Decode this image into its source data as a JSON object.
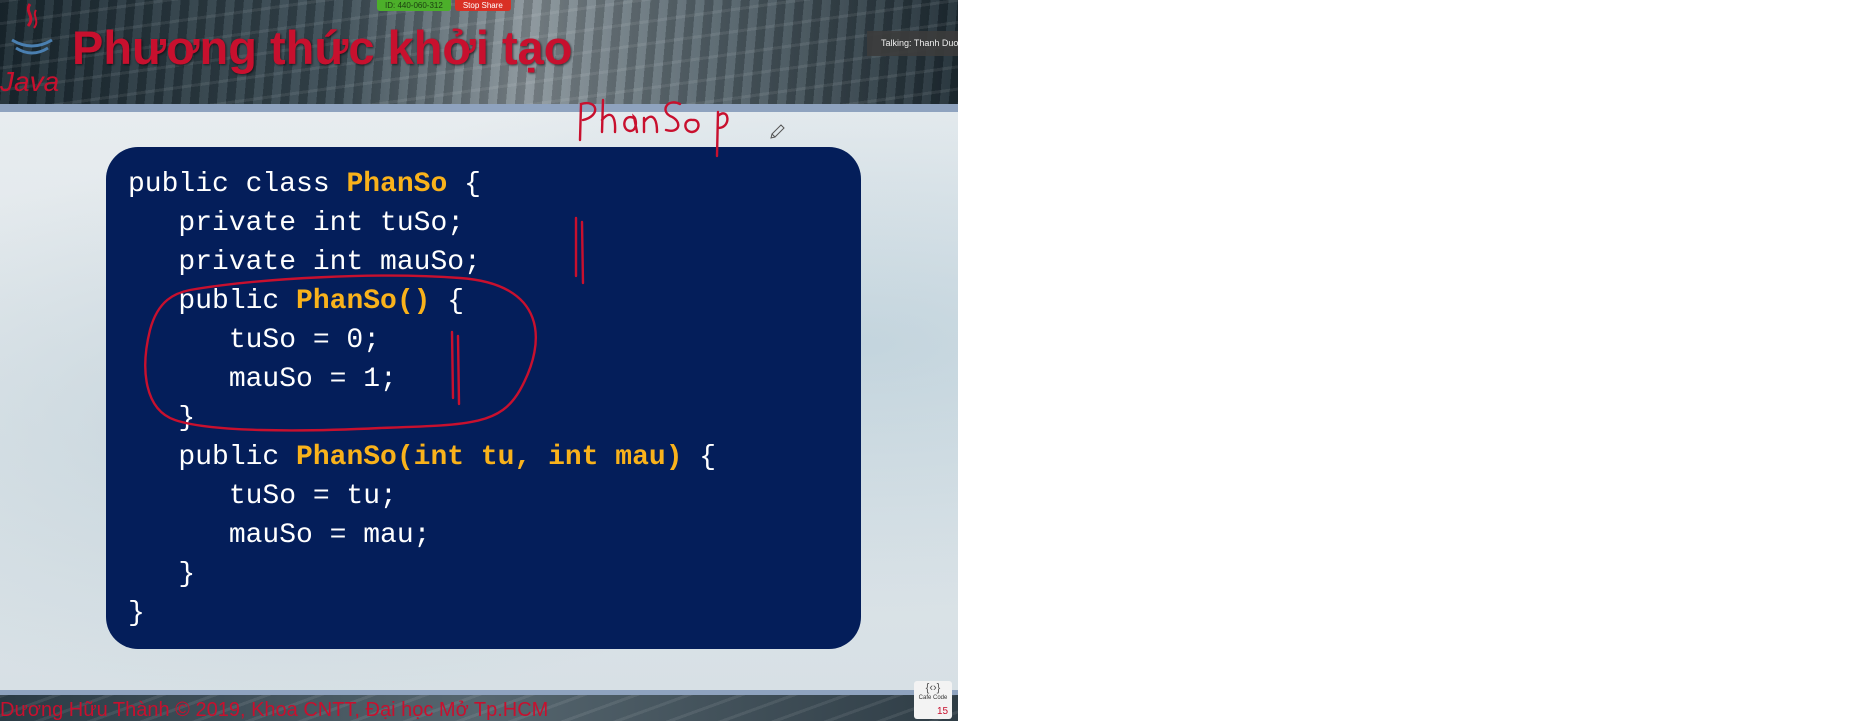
{
  "meeting": {
    "id_label": "ID: 440-060-312",
    "stop_share_label": "Stop Share",
    "talking_label": "Talking: Thanh Duo"
  },
  "slide": {
    "logo_text": "Java",
    "title": "Phương thức khởi tạo",
    "code_lines": [
      [
        "public class ",
        "PhanSo",
        " {"
      ],
      [
        "   private int tuSo;"
      ],
      [
        "   private int mauSo;"
      ],
      [
        "   public ",
        "PhanSo()",
        " {"
      ],
      [
        "      tuSo = 0;"
      ],
      [
        "      mauSo = 1;"
      ],
      [
        "   }"
      ],
      [
        "   public ",
        "PhanSo(int tu, int mau)",
        " {"
      ],
      [
        "      tuSo = tu;"
      ],
      [
        "      mauSo = mau;"
      ],
      [
        "   }"
      ],
      [
        "}"
      ]
    ],
    "footer": "Dương Hữu Thành © 2019, Khoa CNTT, Đại học Mở Tp.HCM",
    "page_number": "15",
    "cafe_logo_text": "Cafe Code"
  },
  "annotation": {
    "handwritten_text": "PhanSo p",
    "ink_color": "#c8102e"
  },
  "colors": {
    "title_red": "#c8102e",
    "code_bg": "#041e5a",
    "code_keyword": "#f9b21b",
    "code_text": "#ffffff"
  }
}
